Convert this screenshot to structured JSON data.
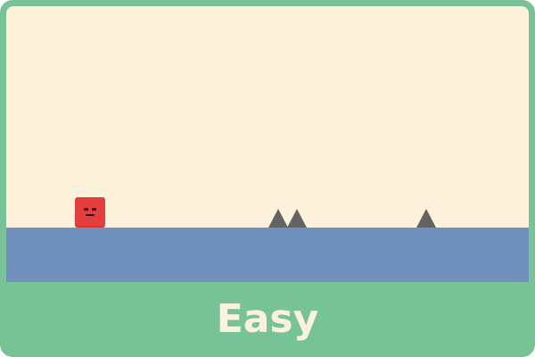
{
  "level": {
    "difficulty_label": "Easy"
  },
  "colors": {
    "frame": "#77C297",
    "sky": "#FEF2DC",
    "ground": "#7190BE",
    "player": "#E43E3E",
    "spike": "#636363",
    "label_text": "#FEF2DC"
  },
  "icons": {
    "player": "red-square-face-icon",
    "obstacle": "triangle-spike-icon"
  }
}
